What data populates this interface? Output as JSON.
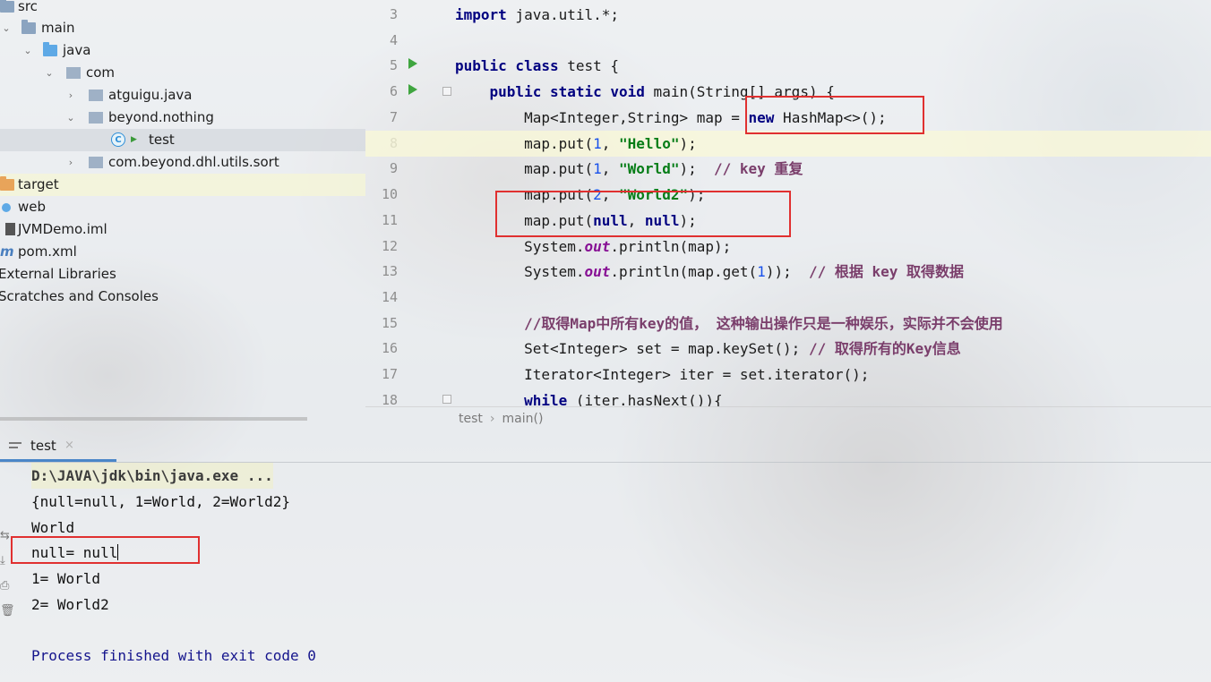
{
  "project_tree": {
    "items": [
      {
        "label": "src",
        "icon": "folder-icon"
      },
      {
        "label": "main",
        "icon": "folder-icon"
      },
      {
        "label": "java",
        "icon": "source-folder-icon"
      },
      {
        "label": "com",
        "icon": "package-icon"
      },
      {
        "label": "atguigu.java",
        "icon": "package-icon"
      },
      {
        "label": "beyond.nothing",
        "icon": "package-icon"
      },
      {
        "label": "test",
        "icon": "java-class-icon"
      },
      {
        "label": "com.beyond.dhl.utils.sort",
        "icon": "package-icon"
      },
      {
        "label": "target",
        "icon": "excluded-folder-icon"
      },
      {
        "label": "web",
        "icon": "web-folder-icon"
      },
      {
        "label": "JVMDemo.iml",
        "icon": "iml-file-icon"
      },
      {
        "label": "pom.xml",
        "icon": "maven-icon"
      },
      {
        "label": "External Libraries",
        "icon": "library-icon"
      },
      {
        "label": "Scratches and Consoles",
        "icon": "scratches-icon"
      }
    ]
  },
  "editor": {
    "line_numbers": [
      "3",
      "4",
      "5",
      "6",
      "7",
      "8",
      "9",
      "10",
      "11",
      "12",
      "13",
      "14",
      "15",
      "16",
      "17",
      "18"
    ],
    "current_line": "8"
  },
  "breadcrumb": {
    "class": "test",
    "method": "main()"
  },
  "run_panel": {
    "tab_label": "test",
    "close_glyph": "×",
    "console_lines": [
      "D:\\JAVA\\jdk\\bin\\java.exe ...",
      "{null=null, 1=World, 2=World2}",
      "World",
      "null= null",
      "1= World",
      "2= World2",
      "",
      "Process finished with exit code 0"
    ]
  },
  "colors": {
    "keyword": "#000080",
    "string": "#067d17",
    "number": "#1750eb",
    "comment": "#7a3e6b",
    "static_field": "#871094",
    "annotation_box": "#e03030"
  }
}
